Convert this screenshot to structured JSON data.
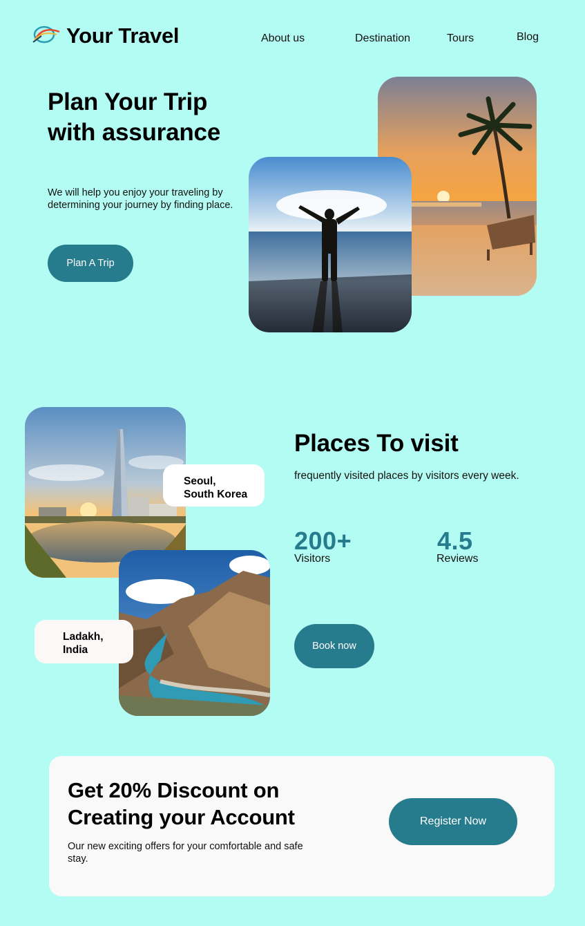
{
  "header": {
    "brand": "Your Travel",
    "nav": [
      {
        "label": "About us"
      },
      {
        "label": "Destination"
      },
      {
        "label": "Tours"
      },
      {
        "label": "Blog"
      }
    ]
  },
  "hero": {
    "title": "Plan Your Trip with assurance",
    "subtitle": "We will help you enjoy your traveling by determining your journey by finding place.",
    "cta_label": "Plan A Trip"
  },
  "places": {
    "title": "Places To visit",
    "subtitle": "frequently visited places by visitors every week.",
    "stats": [
      {
        "value": "200+",
        "label": "Visitors"
      },
      {
        "value": "4.5",
        "label": "Reviews"
      }
    ],
    "cards": [
      {
        "name": "Seoul,\nSouth Korea"
      },
      {
        "name": "Ladakh,\nIndia"
      }
    ],
    "cta_label": "Book now"
  },
  "discount": {
    "title": "Get 20% Discount on Creating your Account",
    "subtitle": "Our new exciting offers for your comfortable and safe stay.",
    "cta_label": "Register Now"
  },
  "colors": {
    "background": "#b3fcf3",
    "accent": "#267b8d",
    "card": "#f9f9f9"
  }
}
